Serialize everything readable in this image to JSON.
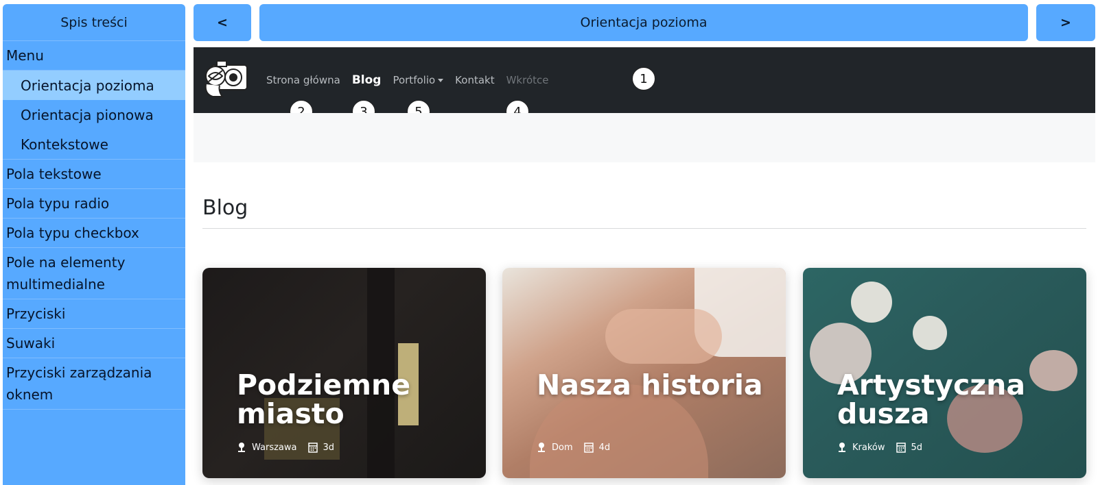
{
  "sidebar": {
    "header": "Spis treści",
    "items": [
      {
        "label": "Menu"
      },
      {
        "label": "Orientacja pozioma"
      },
      {
        "label": "Orientacja pionowa"
      },
      {
        "label": "Kontekstowe"
      },
      {
        "label": "Pola tekstowe"
      },
      {
        "label": "Pola typu radio"
      },
      {
        "label": "Pola typu checkbox"
      },
      {
        "label": "Pole na elementy multimedialne"
      },
      {
        "label": "Przyciski"
      },
      {
        "label": "Suwaki"
      },
      {
        "label": "Przyciski zarządzania oknem"
      }
    ]
  },
  "topnav": {
    "prev_label": "<",
    "title": "Orientacja pozioma",
    "next_label": ">"
  },
  "navbar": {
    "links": [
      {
        "label": "Strona główna"
      },
      {
        "label": "Blog"
      },
      {
        "label": "Portfolio"
      },
      {
        "label": "Kontakt"
      },
      {
        "label": "Wkrótce"
      }
    ],
    "badges": [
      "1",
      "2",
      "3",
      "5",
      "4"
    ]
  },
  "main": {
    "section_title": "Blog",
    "cards": [
      {
        "title": "Podziemne miasto",
        "location": "Warszawa",
        "duration": "3d"
      },
      {
        "title": "Nasza historia",
        "location": "Dom",
        "duration": "4d"
      },
      {
        "title": "Artystyczna dusza",
        "location": "Kraków",
        "duration": "5d"
      }
    ]
  },
  "colors": {
    "accent": "#57a9ff",
    "active_item": "#93cdff",
    "navbar_bg": "#212529"
  }
}
